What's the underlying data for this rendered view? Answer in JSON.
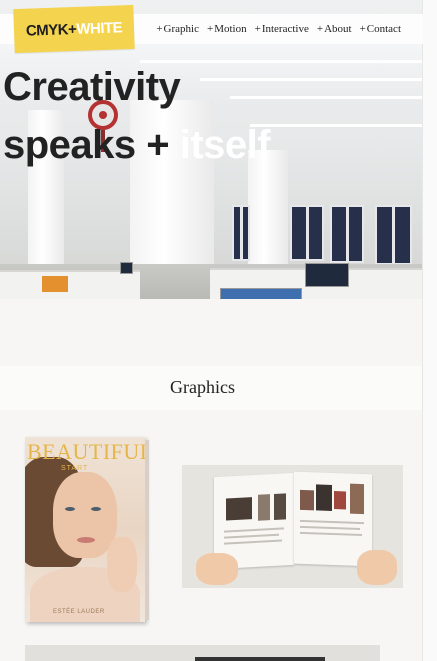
{
  "header": {
    "logo": {
      "part1": "CMYK+",
      "part2": "WHITE"
    },
    "nav": [
      {
        "plus": "+",
        "label": "Graphic"
      },
      {
        "plus": "+",
        "label": "Motion"
      },
      {
        "plus": "+",
        "label": "Interactive"
      },
      {
        "plus": "+",
        "label": "About"
      },
      {
        "plus": "+",
        "label": "Contact"
      }
    ]
  },
  "hero": {
    "line1": "Creativity",
    "line2_dark": "speaks + ",
    "line2_light": "itself"
  },
  "section": {
    "title": "Graphics"
  },
  "gallery": {
    "cover": {
      "title": "BEAUTIFUL",
      "subtitle": "START",
      "brand": "ESTÉE LAUDER"
    }
  },
  "colors": {
    "logo_bg": "#f4d34e",
    "text": "#222222",
    "cover_gold": "#e6b54a"
  }
}
